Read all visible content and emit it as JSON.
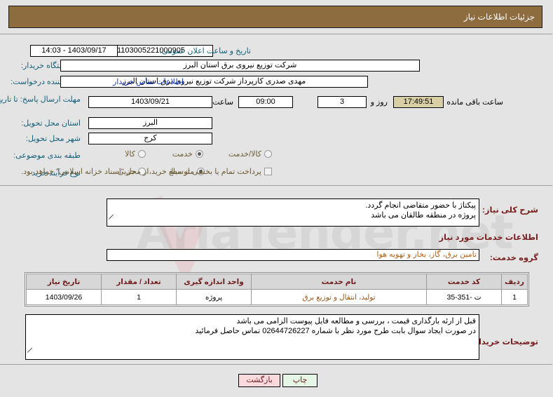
{
  "header": {
    "title": "جزئیات اطلاعات نیاز"
  },
  "form": {
    "need_number_label": "شماره نیاز:",
    "need_number_value": "1103005221000905",
    "announce_label": "تاریخ و ساعت اعلان عمومی:",
    "announce_value": "1403/09/17 - 14:03",
    "buyer_org_label": "نام دستگاه خریدار:",
    "buyer_org_value": "شرکت توزیع نیروی برق استان البرز",
    "creator_label": "ایجاد کننده درخواست:",
    "creator_value": "مهدی صدری کارپرداز شرکت توزیع نیروی برق استان البرز",
    "contact_link": "اطلاعات تماس خریدار",
    "deadline_label": "مهلت ارسال پاسخ: تا تاریخ:",
    "deadline_date": "1403/09/21",
    "hour_label": "ساعت",
    "deadline_time": "09:00",
    "days_value": "3",
    "days_label": "روز و",
    "countdown_value": "17:49:51",
    "remaining_label": "ساعت باقی مانده",
    "province_label": "استان محل تحویل:",
    "province_value": "البرز",
    "city_label": "شهر محل تحویل:",
    "city_value": "کرج",
    "classification_label": "طبقه بندی موضوعی:",
    "classification_options": [
      {
        "label": "کالا",
        "selected": false
      },
      {
        "label": "خدمت",
        "selected": true
      },
      {
        "label": "کالا/خدمت",
        "selected": false
      }
    ],
    "process_label": "نوع فرآیند خرید :",
    "process_options": [
      {
        "label": "جزیی",
        "selected": false
      },
      {
        "label": "متوسط",
        "selected": true
      }
    ],
    "treasury_checkbox_label": "پرداخت تمام یا بخشی از مبلغ خرید،از محل \"اسناد خزانه اسلامی\" خواهد بود.",
    "treasury_checked": false
  },
  "description": {
    "label": "شرح کلی نیاز:",
    "value": "پیکتاژ با حضور متقاضی انجام گردد.\nپروژه در منطقه طالقان می باشد"
  },
  "services_section": {
    "heading": "اطلاعات خدمات مورد نیاز",
    "group_label": "گروه خدمت:",
    "group_value": "تامین برق، گاز، بخار و تهویه هوا"
  },
  "table": {
    "columns": [
      "ردیف",
      "کد خدمت",
      "نام خدمت",
      "واحد اندازه گیری",
      "تعداد / مقدار",
      "تاریخ نیاز"
    ],
    "rows": [
      {
        "row_no": "1",
        "code": "ت -351-35",
        "name": "تولید، انتقال و توزیع برق",
        "unit": "پروژه",
        "qty": "1",
        "need_date": "1403/09/26"
      }
    ]
  },
  "notes": {
    "label": "توضیحات خریدار:",
    "value": "قبل از ارئه بارگذاری قیمت ، بررسی و مطالعه فایل پیوست الزامی می باشد\nدر صورت ایجاد سوال بابت طرح مورد نظر با شماره 02644726227 تماس حاصل فرمائید"
  },
  "buttons": {
    "print": "چاپ",
    "back": "بازگشت"
  },
  "watermark": {
    "text": "AriaTender.net"
  }
}
